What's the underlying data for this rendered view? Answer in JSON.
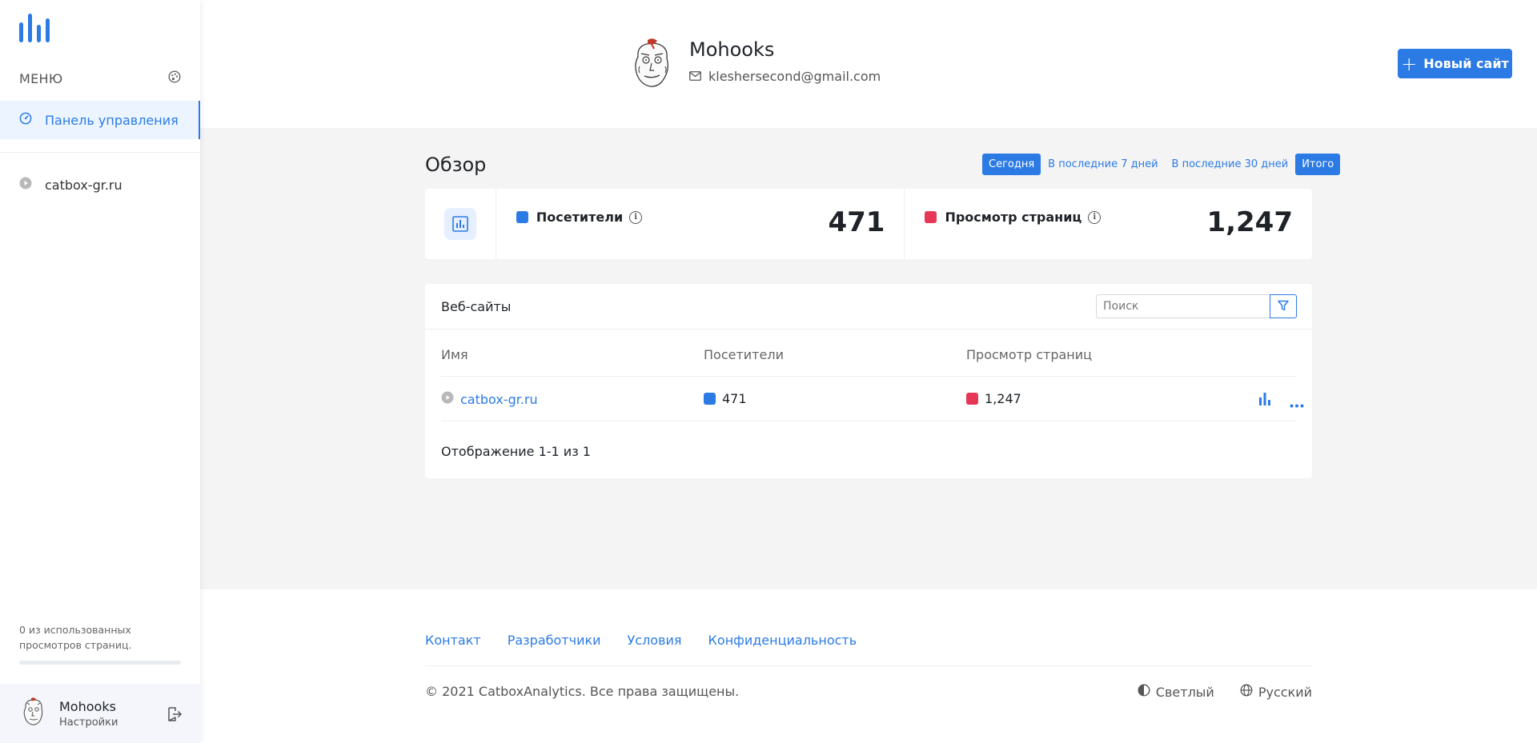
{
  "sidebar": {
    "menu_label": "МЕНЮ",
    "nav_dashboard": "Панель управления",
    "sites": [
      "catbox-gr.ru"
    ],
    "usage_text": "0 из использованных просмотров страниц.",
    "usage_fraction": 0.0,
    "user_name": "Mohooks",
    "user_settings": "Настройки"
  },
  "header": {
    "name": "Mohooks",
    "email": "kleshersecond@gmail.com",
    "new_site": "Новый сайт"
  },
  "overview": {
    "title": "Обзор",
    "ranges": [
      "Сегодня",
      "В последние 7 дней",
      "В последние 30 дней",
      "Итого"
    ],
    "visitors_label": "Посетители",
    "visitors_value": "471",
    "pageviews_label": "Просмотр страниц",
    "pageviews_value": "1,247"
  },
  "websites": {
    "title": "Веб-сайты",
    "search_placeholder": "Поиск",
    "columns": [
      "Имя",
      "Посетители",
      "Просмотр страниц"
    ],
    "rows": [
      {
        "name": "catbox-gr.ru",
        "visitors": "471",
        "pageviews": "1,247"
      }
    ],
    "footer": "Отображение 1-1 из 1"
  },
  "footer": {
    "links": [
      "Контакт",
      "Разработчики",
      "Условия",
      "Конфиденциальность"
    ],
    "copyright": "© 2021 CatboxAnalytics. Все права защищены.",
    "theme": "Светлый",
    "language": "Русский"
  },
  "colors": {
    "accent": "#2c7be5",
    "visitors": "#2c7be5",
    "pageviews": "#e63757"
  }
}
